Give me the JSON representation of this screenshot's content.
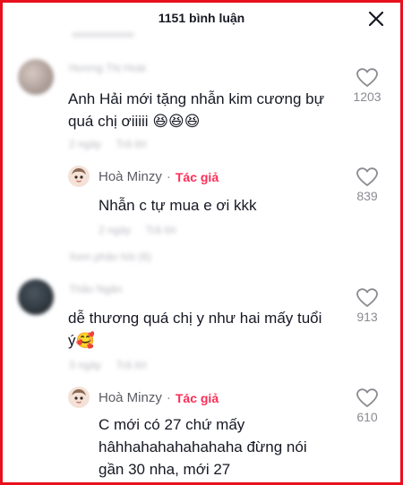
{
  "header": {
    "title": "1151 bình luận"
  },
  "comments": [
    {
      "username": "Hương Thị Hoài",
      "text": "Anh Hải mới tặng nhẫn kim cương bự",
      "text_line2": "quá chị ơiiiii",
      "emojis": "😆😆😆",
      "time": "2 ngày",
      "reply_label": "Trả lời",
      "likes": "1203",
      "reply": {
        "username": "Hoà Minzy",
        "badge": "Tác giả",
        "separator": "·",
        "text": "Nhẫn c tự mua e ơi kkk",
        "time": "2 ngày",
        "reply_label": "Trả lời",
        "likes": "839"
      },
      "view_more": "Xem phản hồi (6)"
    },
    {
      "username": "Thảo Ngân",
      "text": "dễ thương quá chị y như hai mấy tuổi",
      "text_line2": "ý",
      "emojis": "🥰",
      "time": "3 ngày",
      "reply_label": "Trả lời",
      "likes": "913",
      "reply": {
        "username": "Hoà Minzy",
        "badge": "Tác giả",
        "separator": "·",
        "text_line1": "C mới có 27 chứ mấy",
        "text_line2": "hâhhahahahahahaha đừng nói",
        "text_line3": "gần 30 nha, mới 27",
        "likes": "610"
      }
    }
  ],
  "colors": {
    "accent": "#fe2c55",
    "frame": "#e8101e",
    "text": "#161823",
    "muted": "#8a8b91"
  }
}
